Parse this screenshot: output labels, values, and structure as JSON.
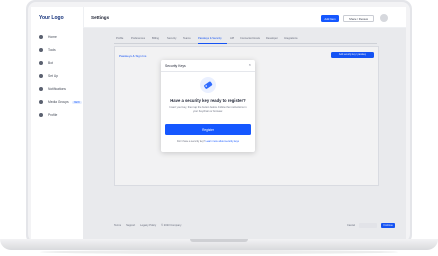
{
  "sidebar": {
    "logo": "Your Logo",
    "items": [
      {
        "label": "Home"
      },
      {
        "label": "Tools"
      },
      {
        "label": "Bot"
      },
      {
        "label": "Set Up"
      },
      {
        "label": "Notifications"
      },
      {
        "label": "Media Groups",
        "badge": "NEW"
      },
      {
        "label": "Profile"
      }
    ]
  },
  "topbar": {
    "title": "Settings",
    "primary_label": "Add Item",
    "secondary_label": "Share / Review"
  },
  "tabs": [
    {
      "label": "Profile"
    },
    {
      "label": "Preferences"
    },
    {
      "label": "Billing"
    },
    {
      "label": "Security"
    },
    {
      "label": "Teams"
    },
    {
      "label": "Passkeys & Security"
    },
    {
      "label": "API"
    },
    {
      "label": "Connected Hosts"
    },
    {
      "label": "Developer"
    },
    {
      "label": "Integrations"
    }
  ],
  "content": {
    "section_link": "Passkeys & Sign Ins",
    "add_key_label": "Add security key / passkey"
  },
  "footer": {
    "links": [
      "Terms",
      "Support",
      "Legacy Policy",
      "© 2023 Company"
    ],
    "right_text": "Cancel",
    "right_button": "Continue"
  },
  "modal": {
    "title": "Security Keys",
    "close_glyph": "×",
    "heading": "Have a security key ready to register?",
    "body": "Insert your key, then tap the button below. Follow the instructions in your Keychain or browser.",
    "cta_label": "Register",
    "footnote_prefix": "Don't have a security key?",
    "footnote_link": "Learn more about security keys"
  },
  "colors": {
    "accent": "#1557ff",
    "brand_logo": "#14317a"
  }
}
